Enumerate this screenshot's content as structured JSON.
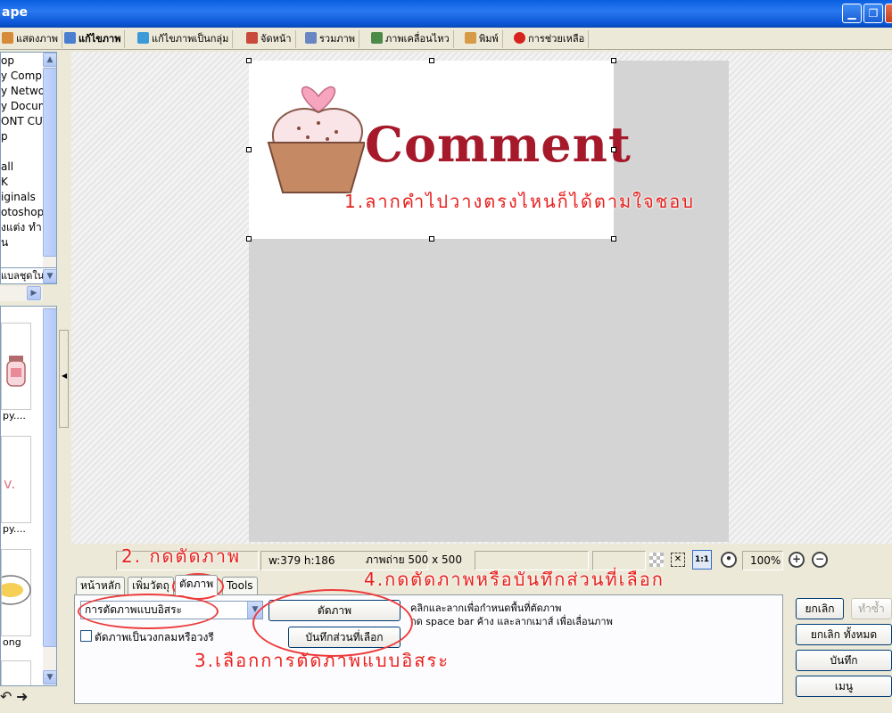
{
  "window": {
    "title": "ape",
    "colors": {
      "titlebar": "#0a5fe0",
      "close": "#c6421c",
      "annotation": "#e8201d"
    }
  },
  "toolbar": {
    "items": [
      {
        "label": "แสดงภาพ",
        "icon": "photo-stack-icon"
      },
      {
        "label": "แก้ไขภาพ",
        "icon": "edit-photo-icon"
      },
      {
        "label": "แก้ไขภาพเป็นกลุ่ม",
        "icon": "batch-edit-icon"
      },
      {
        "label": "จัดหน้า",
        "icon": "layout-icon"
      },
      {
        "label": "รวมภาพ",
        "icon": "combine-icon"
      },
      {
        "label": "ภาพเคลื่อนไหว",
        "icon": "animation-icon"
      },
      {
        "label": "พิมพ์",
        "icon": "printer-icon"
      },
      {
        "label": "การช่วยเหลือ",
        "icon": "help-icon"
      }
    ]
  },
  "tree": {
    "items": [
      "op",
      "y Compu",
      "y Netwo",
      "y Docum",
      "ONT CUT",
      "p",
      "",
      "all",
      "K",
      "iginals",
      "otoshop",
      "งแต่ง ทำ",
      "น"
    ]
  },
  "left_combo": {
    "value": "แบลชุดใน"
  },
  "thumbnails": [
    {
      "label": "py...."
    },
    {
      "label": "py...."
    },
    {
      "label": "ong"
    }
  ],
  "canvas": {
    "comment_text": "Comment"
  },
  "status": {
    "size": "w:379 h:186",
    "photo": "ภาพถ่าย 500 x 500",
    "zoom": "100%"
  },
  "bottom_tabs": [
    "หน้าหลัก",
    "เพิ่มวัตถุ",
    "ตัดภาพ",
    "Tools"
  ],
  "crop_panel": {
    "mode_select": "การตัดภาพแบบอิสระ",
    "crop_button": "ตัดภาพ",
    "save_selection_button": "บันทึกส่วนที่เลือก",
    "circle_checkbox": "ตัดภาพเป็นวงกลมหรือวงรี",
    "hint_line1": "คลิกและลากเพื่อกำหนดพื้นที่ตัดภาพ",
    "hint_line2": "กด space bar ค้าง และลากเมาส์ เพื่อเลื่อนภาพ"
  },
  "right_buttons": {
    "cancel": "ยกเลิก",
    "redo": "ทำซ้ำ",
    "cancel_all": "ยกเลิก ทั้งหมด",
    "save": "บันทึก",
    "menu": "เมนู"
  },
  "annotations": {
    "step1": "1.ลากคำไปวางตรงไหนก็ได้ตามใจชอบ",
    "step2": "2. กดตัดภาพ",
    "step3": "3.เลือกการตัดภาพแบบอิสระ",
    "step4": "4.กดตัดภาพหรือบันทึกส่วนที่เลือก"
  }
}
